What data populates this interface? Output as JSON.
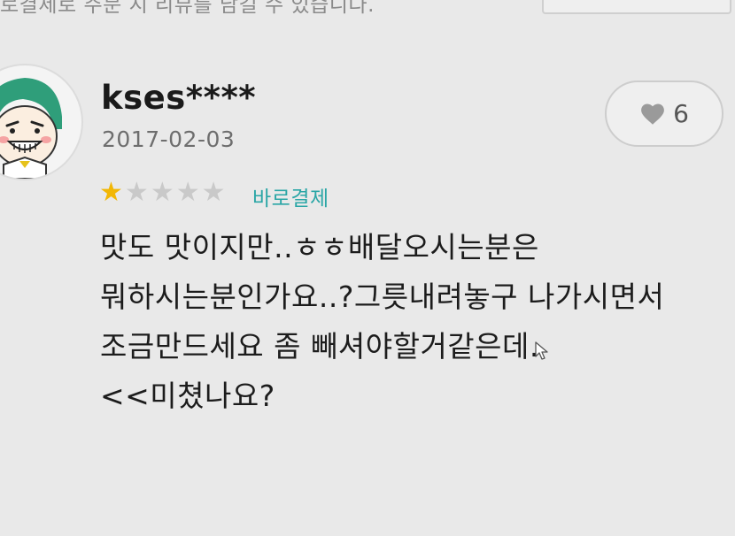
{
  "top_text": "로결제로 주문 시 리뷰를 남길 수 있습니다.",
  "review": {
    "username": "kses****",
    "date": "2017-02-03",
    "rating": 1,
    "rating_max": 5,
    "order_type": "바로결제",
    "like_count": "6",
    "lines": [
      "맛도 맛이지만..ㅎㅎ배달오시는분은",
      "뭐하시는분인가요..?그릇내려놓구 나가시면서",
      "조금만드세요 좀 빼셔야할거같은데.",
      "<<미쳤나요?"
    ]
  },
  "colors": {
    "star_filled": "#f2b705",
    "star_empty": "#c9c9c9",
    "badge": "#2aa6a6",
    "background": "#e9e9e9"
  },
  "icons": {
    "avatar": "character-avatar-icon",
    "like": "heart-icon",
    "star": "star-icon",
    "cursor": "mouse-cursor-icon"
  }
}
